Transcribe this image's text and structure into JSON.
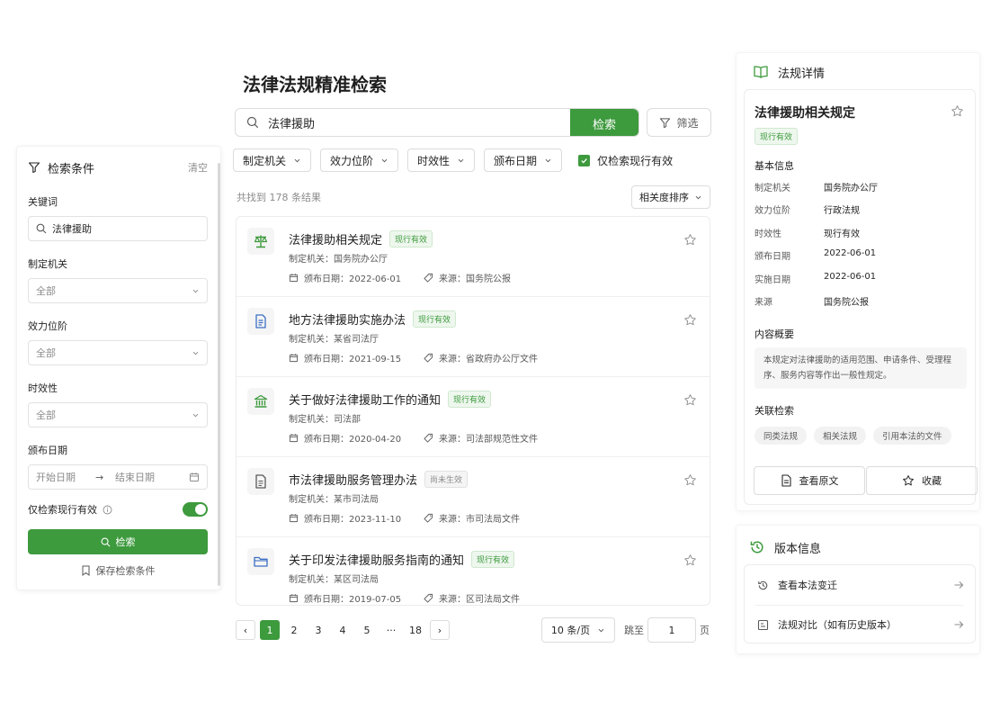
{
  "filter_panel": {
    "title": "检索条件",
    "clear_label": "清空",
    "keyword_label": "关键词",
    "keyword_value": "法律援助",
    "authority_label": "制定机关",
    "authority_value": "全部",
    "level_label": "效力位阶",
    "level_value": "全部",
    "validity_label": "时效性",
    "validity_value": "全部",
    "date_label": "颁布日期",
    "date_start_placeholder": "开始日期",
    "date_arrow": "→",
    "date_end_placeholder": "结束日期",
    "only_valid_label": "仅检索现行有效",
    "only_valid_on": true,
    "search_button": "检索",
    "save_label": "保存检索条件"
  },
  "main": {
    "title": "法律法规精准检索",
    "search_value": "法律援助",
    "search_button": "检索",
    "filter_button": "筛选",
    "chips": [
      "制定机关",
      "效力位阶",
      "时效性",
      "颁布日期"
    ],
    "only_valid_label": "仅检索现行有效",
    "result_count": "共找到 178 条结果",
    "sort_label": "相关度排序",
    "results": [
      {
        "title": "法律援助相关规定",
        "badge": "现行有效",
        "badge_type": "valid",
        "org": "制定机关：国务院办公厅",
        "date": "颁布日期：2022-06-01",
        "source": "来源：国务院公报",
        "icon": "scale-icon"
      },
      {
        "title": "地方法律援助实施办法",
        "badge": "现行有效",
        "badge_type": "valid",
        "org": "制定机关：某省司法厅",
        "date": "颁布日期：2021-09-15",
        "source": "来源：省政府办公厅文件",
        "icon": "document-icon"
      },
      {
        "title": "关于做好法律援助工作的通知",
        "badge": "现行有效",
        "badge_type": "valid",
        "org": "制定机关：司法部",
        "date": "颁布日期：2020-04-20",
        "source": "来源：司法部规范性文件",
        "icon": "institution-icon"
      },
      {
        "title": "市法律援助服务管理办法",
        "badge": "尚未生效",
        "badge_type": "pending",
        "org": "制定机关：某市司法局",
        "date": "颁布日期：2023-11-10",
        "source": "来源：市司法局文件",
        "icon": "file-icon"
      },
      {
        "title": "关于印发法律援助服务指南的通知",
        "badge": "现行有效",
        "badge_type": "valid",
        "org": "制定机关：某区司法局",
        "date": "颁布日期：2019-07-05",
        "source": "来源：区司法局文件",
        "icon": "folder-icon"
      }
    ],
    "pagination": {
      "prev": "‹",
      "pages": [
        "1",
        "2",
        "3",
        "4",
        "5"
      ],
      "current": "1",
      "ellipsis": "···",
      "last": "18",
      "next": "›",
      "page_size": "10 条/页",
      "jump_label": "跳至",
      "jump_value": "1",
      "jump_unit": "页"
    }
  },
  "detail": {
    "panel_title": "法规详情",
    "title": "法律援助相关规定",
    "badge": "现行有效",
    "basic_title": "基本信息",
    "fields": [
      {
        "k": "制定机关",
        "v": "国务院办公厅"
      },
      {
        "k": "效力位阶",
        "v": "行政法规"
      },
      {
        "k": "时效性",
        "v": "现行有效"
      },
      {
        "k": "颁布日期",
        "v": "2022-06-01"
      },
      {
        "k": "实施日期",
        "v": "2022-06-01"
      },
      {
        "k": "来源",
        "v": "国务院公报"
      }
    ],
    "summary_title": "内容概要",
    "summary": "本规定对法律援助的适用范围、申请条件、受理程序、服务内容等作出一般性规定。",
    "related_title": "关联检索",
    "related_tags": [
      "同类法规",
      "相关法规",
      "引用本法的文件"
    ],
    "view_button": "查看原文",
    "fav_button": "收藏"
  },
  "versions": {
    "title": "版本信息",
    "items": [
      "查看本法变迁",
      "法规对比（如有历史版本）"
    ]
  },
  "colors": {
    "accent": "#3d9a3d",
    "border": "#dcdcdc",
    "muted": "#8c8c8c"
  }
}
